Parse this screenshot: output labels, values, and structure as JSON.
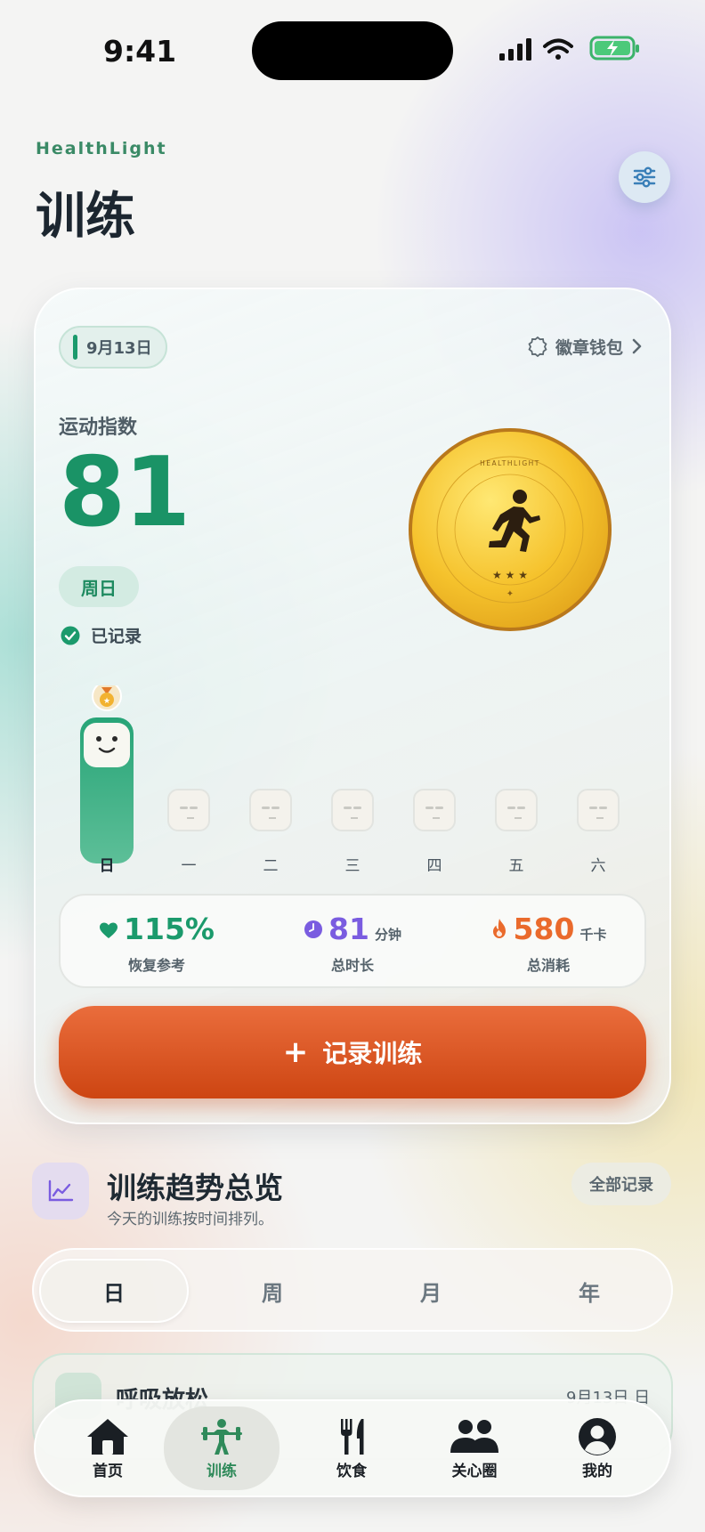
{
  "status_bar": {
    "time": "9:41"
  },
  "header": {
    "brand": "HealthLight",
    "title": "训练"
  },
  "card": {
    "date_chip": "9月13日",
    "badge_wallet": "徽章钱包",
    "index_label": "运动指数",
    "score": "81",
    "weekday": "周日",
    "recorded": "已记录",
    "medal_text": "HEALTHLIGHT",
    "week": {
      "days": [
        "日",
        "一",
        "二",
        "三",
        "四",
        "五",
        "六"
      ]
    },
    "stats": [
      {
        "value": "115%",
        "unit": "",
        "caption": "恢复参考",
        "color": "#1b9a6c",
        "icon": "heart-icon"
      },
      {
        "value": "81",
        "unit": "分钟",
        "caption": "总时长",
        "color": "#7a5ce0",
        "icon": "clock-icon"
      },
      {
        "value": "580",
        "unit": "千卡",
        "caption": "总消耗",
        "color": "#ea6a2c",
        "icon": "flame-icon"
      }
    ],
    "record_button": "记录训练"
  },
  "trends": {
    "title": "训练趋势总览",
    "subtitle": "今天的训练按时间排列。",
    "all_records": "全部记录",
    "segments": [
      "日",
      "周",
      "月",
      "年"
    ],
    "active_segment": "日"
  },
  "peek": {
    "title": "呼吸放松",
    "date": "9月13日 日"
  },
  "tabbar": {
    "items": [
      "首页",
      "训练",
      "饮食",
      "关心圈",
      "我的"
    ],
    "active": "训练"
  },
  "colors": {
    "accent_green": "#1a9366",
    "accent_orange": "#d24d18",
    "accent_purple": "#7a5ce0"
  }
}
